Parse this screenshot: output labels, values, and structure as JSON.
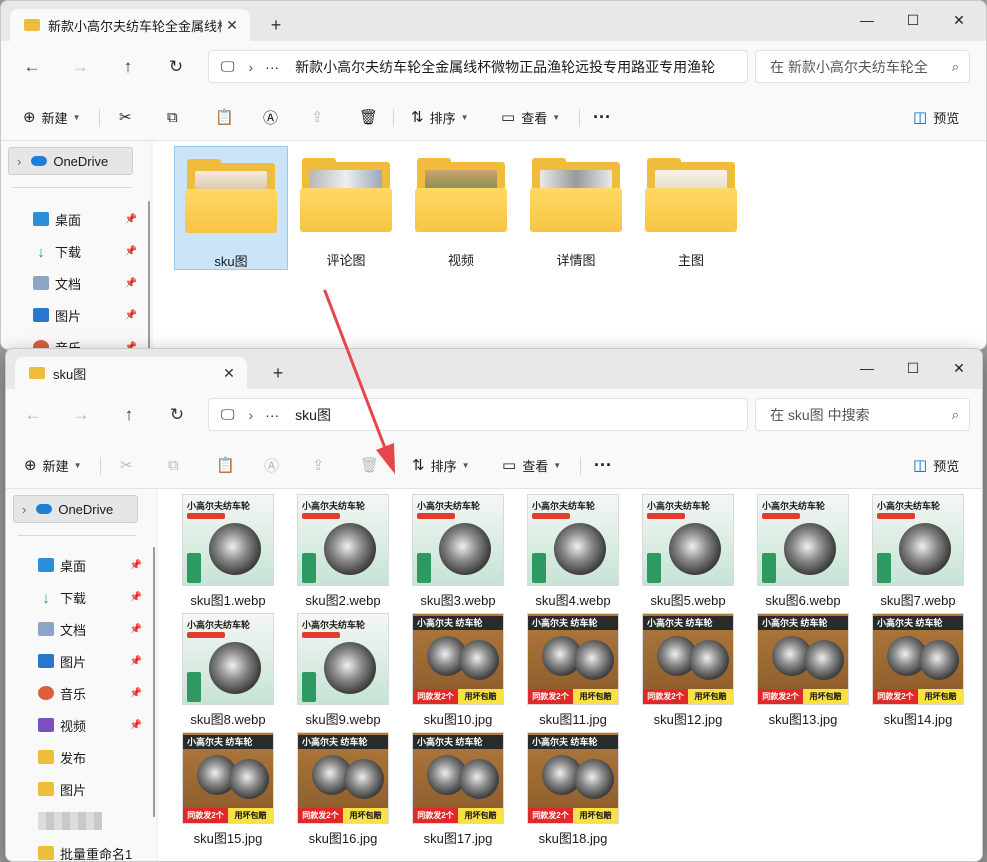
{
  "colors": {
    "accent": "#0067c0",
    "folder": "#f0bc3c",
    "selection": "#cce4f7",
    "arrow": "#e8454a"
  },
  "window_back": {
    "tab_title": "新款小高尔夫纺车轮全金属线杯",
    "address": "新款小高尔夫纺车轮全金属线杯微物正品渔轮远投专用路亚专用渔轮",
    "search_placeholder": "在 新款小高尔夫纺车轮全",
    "commands": {
      "new": "新建",
      "sort": "排序",
      "view": "查看",
      "preview": "预览"
    },
    "sidebar": {
      "onedrive": "OneDrive",
      "items": [
        {
          "label": "桌面",
          "icon": "desktop-icon"
        },
        {
          "label": "下载",
          "icon": "download-icon"
        },
        {
          "label": "文档",
          "icon": "document-icon"
        },
        {
          "label": "图片",
          "icon": "pictures-icon"
        },
        {
          "label": "音乐",
          "icon": "music-icon"
        }
      ]
    },
    "folders": [
      {
        "label": "sku图"
      },
      {
        "label": "评论图"
      },
      {
        "label": "视频"
      },
      {
        "label": "详情图"
      },
      {
        "label": "主图"
      }
    ]
  },
  "window_front": {
    "tab_title": "sku图",
    "address": "sku图",
    "search_placeholder": "在 sku图 中搜索",
    "commands": {
      "new": "新建",
      "sort": "排序",
      "view": "查看",
      "preview": "预览"
    },
    "sidebar": {
      "onedrive": "OneDrive",
      "items": [
        {
          "label": "桌面",
          "icon": "desktop-icon"
        },
        {
          "label": "下载",
          "icon": "download-icon"
        },
        {
          "label": "文档",
          "icon": "document-icon"
        },
        {
          "label": "图片",
          "icon": "pictures-icon"
        },
        {
          "label": "音乐",
          "icon": "music-icon"
        },
        {
          "label": "视频",
          "icon": "video-icon"
        },
        {
          "label": "发布",
          "icon": "folder-icon"
        },
        {
          "label": "图片",
          "icon": "folder-icon"
        },
        {
          "label": "",
          "icon": "blurred-item"
        },
        {
          "label": "批量重命名1",
          "icon": "folder-icon"
        }
      ]
    },
    "files": [
      {
        "name": "sku图1.webp",
        "style": "green",
        "caption": "小高尔夫纺车轮"
      },
      {
        "name": "sku图2.webp",
        "style": "green",
        "caption": "小高尔夫纺车轮"
      },
      {
        "name": "sku图3.webp",
        "style": "green",
        "caption": "小高尔夫纺车轮"
      },
      {
        "name": "sku图4.webp",
        "style": "green",
        "caption": "小高尔夫纺车轮"
      },
      {
        "name": "sku图5.webp",
        "style": "green",
        "caption": "小高尔夫纺车轮"
      },
      {
        "name": "sku图6.webp",
        "style": "green",
        "caption": "小高尔夫纺车轮"
      },
      {
        "name": "sku图7.webp",
        "style": "green",
        "caption": "小高尔夫纺车轮"
      },
      {
        "name": "sku图8.webp",
        "style": "green",
        "caption": "小高尔夫纺车轮"
      },
      {
        "name": "sku图9.webp",
        "style": "green",
        "caption": "小高尔夫纺车轮"
      },
      {
        "name": "sku图10.jpg",
        "style": "brown",
        "caption": "小高尔夫 纺车轮",
        "band_left": "同款发2个",
        "band_right": "用坏包赔"
      },
      {
        "name": "sku图11.jpg",
        "style": "brown",
        "caption": "小高尔夫 纺车轮",
        "band_left": "同款发2个",
        "band_right": "用坏包赔"
      },
      {
        "name": "sku图12.jpg",
        "style": "brown",
        "caption": "小高尔夫 纺车轮",
        "band_left": "同款发2个",
        "band_right": "用坏包赔"
      },
      {
        "name": "sku图13.jpg",
        "style": "brown",
        "caption": "小高尔夫 纺车轮",
        "band_left": "同款发2个",
        "band_right": "用坏包赔"
      },
      {
        "name": "sku图14.jpg",
        "style": "brown",
        "caption": "小高尔夫 纺车轮",
        "band_left": "同款发2个",
        "band_right": "用坏包赔"
      },
      {
        "name": "sku图15.jpg",
        "style": "brown",
        "caption": "小高尔夫 纺车轮",
        "band_left": "同款发2个",
        "band_right": "用坏包赔"
      },
      {
        "name": "sku图16.jpg",
        "style": "brown",
        "caption": "小高尔夫 纺车轮",
        "band_left": "同款发2个",
        "band_right": "用坏包赔"
      },
      {
        "name": "sku图17.jpg",
        "style": "brown",
        "caption": "小高尔夫 纺车轮",
        "band_left": "同款发2个",
        "band_right": "用坏包赔"
      },
      {
        "name": "sku图18.jpg",
        "style": "brown",
        "caption": "小高尔夫 纺车轮",
        "band_left": "同款发2个",
        "band_right": "用坏包赔"
      }
    ]
  }
}
